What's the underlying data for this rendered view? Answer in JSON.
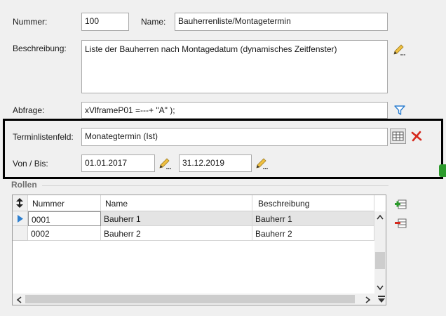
{
  "form": {
    "nummer_label": "Nummer:",
    "nummer_value": "100",
    "name_label": "Name:",
    "name_value": "Bauherrenliste/Montagetermin",
    "beschreibung_label": "Beschreibung:",
    "beschreibung_value": "Liste der Bauherren nach Montagedatum (dynamisches Zeitfenster)",
    "abfrage_label": "Abfrage:",
    "abfrage_value": "xVlframeP01 =---+ \"A\" );",
    "terminlistenfeld_label": "Terminlistenfeld:",
    "terminlistenfeld_value": "Monategtermin (Ist)",
    "vonbis_label": "Von / Bis:",
    "von_value": "01.01.2017",
    "bis_value": "31.12.2019"
  },
  "rollen": {
    "title": "Rollen",
    "columns": [
      "Nummer",
      "Name",
      "Beschreibung"
    ],
    "rows": [
      {
        "nummer": "0001",
        "name": "Bauherr 1",
        "beschreibung": "Bauherr 1"
      },
      {
        "nummer": "0002",
        "name": "Bauherr 2",
        "beschreibung": "Bauherr 2"
      }
    ]
  },
  "icons": {
    "edit": "pencil-icon",
    "filter": "filter-icon",
    "table": "table-icon",
    "delete": "red-x-icon",
    "add_row": "add-row-icon",
    "remove_row": "remove-row-icon",
    "sort": "sort-arrows-icon"
  },
  "colors": {
    "highlight_border": "#000000",
    "filter_blue": "#2d7fd0",
    "delete_red": "#d62a1e",
    "row_selected": "#e4e4e4"
  }
}
